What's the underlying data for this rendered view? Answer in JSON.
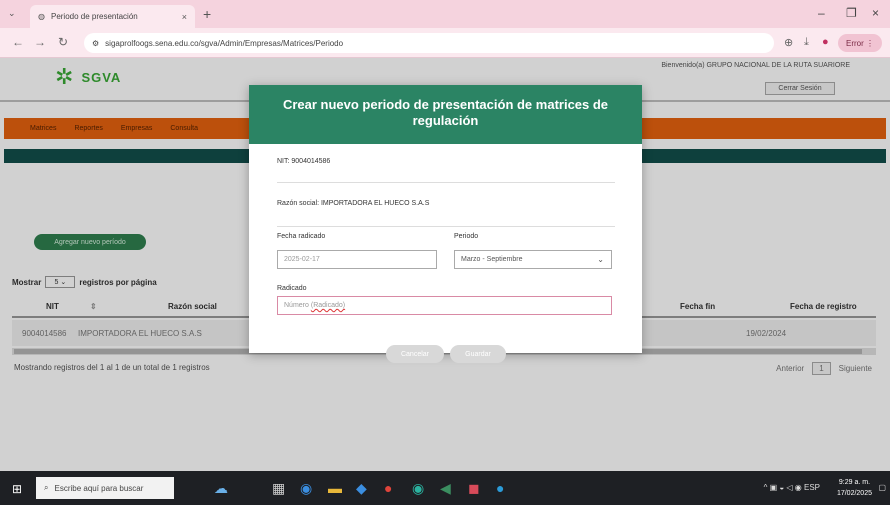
{
  "browser": {
    "tab_title": "Periodo de presentación",
    "tab_close": "×",
    "new_tab": "+",
    "url": "sigaprolfoogs.sena.edu.co/sgva/Admin/Empresas/Matrices/Periodo",
    "profile_label": "Error",
    "window_controls": [
      "–",
      "❐",
      "×"
    ]
  },
  "header": {
    "logo_text": "SGVA",
    "welcome": "Bienvenido(a) GRUPO NACIONAL DE LA RUTA SUARIORE",
    "logout": "Cerrar Sesión"
  },
  "nav_menu": {
    "items": [
      "Matrices",
      "Reportes",
      "Empresas",
      "Consulta"
    ]
  },
  "page": {
    "add_period_button": "Agregar nuevo período",
    "show_label_pre": "Mostrar",
    "show_value": "5",
    "show_label_post": "registros por página",
    "columns": [
      "NIT",
      "Razón social",
      "Fecha fin",
      "Fecha de registro"
    ],
    "row": {
      "nit": "9004014586",
      "razon": "IMPORTADORA EL HUECO S.A.S",
      "fecha_registro": "19/02/2024"
    },
    "info": "Mostrando registros del 1 al 1 de un total de 1 registros",
    "pager_prev": "Anterior",
    "pager_current": "1",
    "pager_next": "Siguiente"
  },
  "modal": {
    "title": "Crear nuevo periodo de presentación de matrices de regulación",
    "nit": "NIT: 9004014586",
    "razon_social": "Razón social: IMPORTADORA EL HUECO S.A.S",
    "fecha_label": "Fecha radicado",
    "fecha_value": "2025-02-17",
    "periodo_label": "Periodo",
    "periodo_value": "Marzo - Septiembre",
    "radicado_label": "Radicado",
    "radicado_placeholder": "Número",
    "radicado_suffix": "(Radicado)",
    "cancel": "Cancelar",
    "save": "Guardar"
  },
  "taskbar": {
    "search_placeholder": "Escribe aquí para buscar",
    "time": "9:29 a. m.",
    "date": "17/02/2025"
  }
}
